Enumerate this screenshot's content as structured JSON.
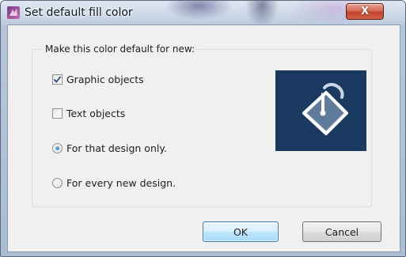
{
  "window": {
    "title": "Set default fill color",
    "close_label": "X"
  },
  "group": {
    "caption": "Make this color default for new:"
  },
  "options": {
    "graphic_objects": {
      "label": "Graphic objects",
      "checked": true
    },
    "text_objects": {
      "label": "Text objects",
      "checked": false
    },
    "that_design_only": {
      "label": "For that design only.",
      "selected": true
    },
    "every_new_design": {
      "label": "For every new design.",
      "selected": false
    }
  },
  "preview": {
    "icon": "paint-bucket-icon",
    "background_color": "#1b3a62"
  },
  "buttons": {
    "ok_label": "OK",
    "cancel_label": "Cancel"
  }
}
